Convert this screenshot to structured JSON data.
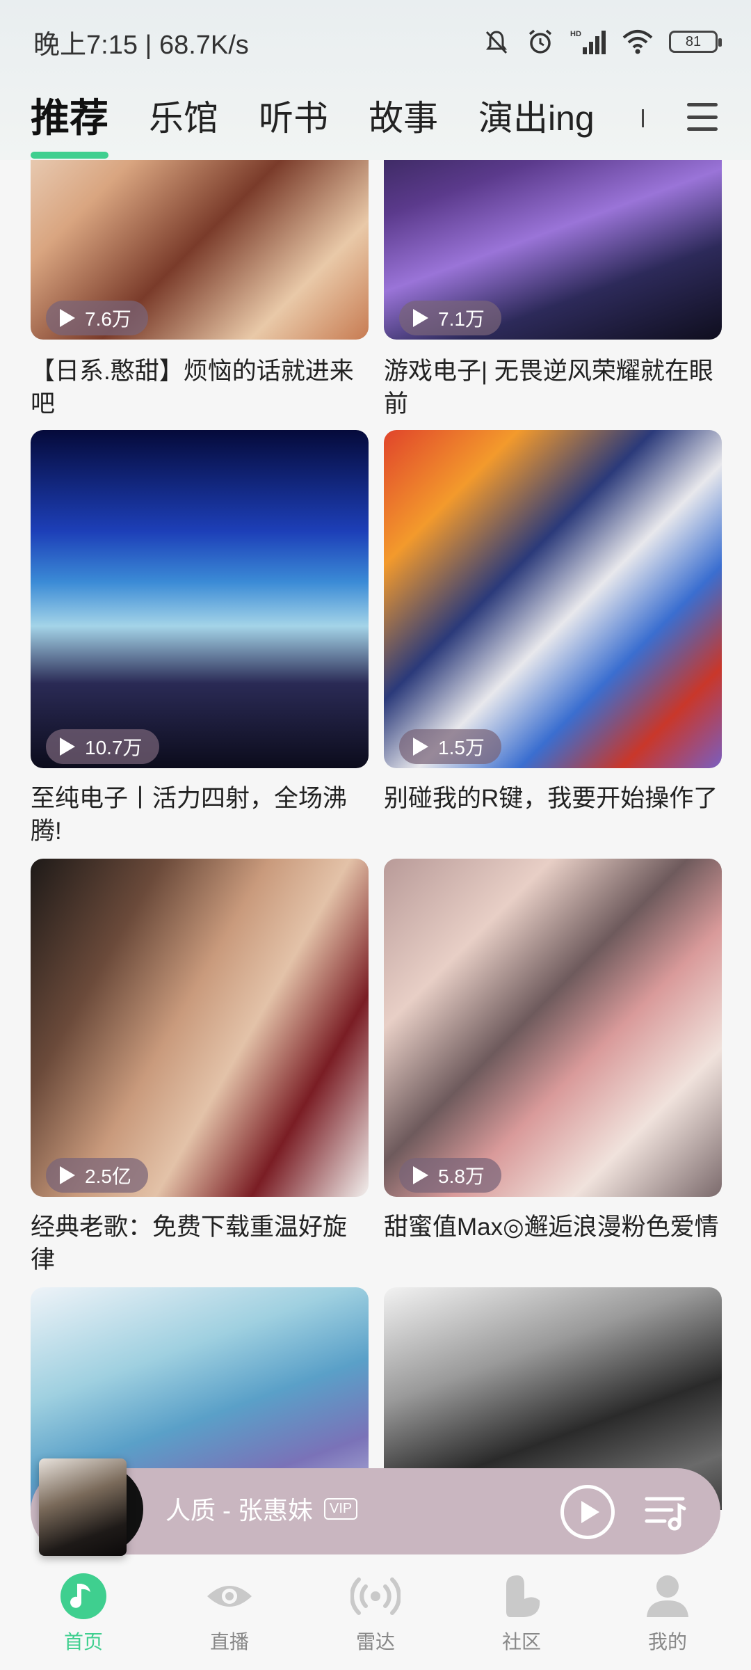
{
  "status_bar": {
    "time_speed": "晚上7:15 | 68.7K/s",
    "battery": "81"
  },
  "tabs": [
    {
      "label": "推荐",
      "active": true
    },
    {
      "label": "乐馆"
    },
    {
      "label": "听书"
    },
    {
      "label": "故事"
    },
    {
      "label": "演出ing"
    }
  ],
  "cards": [
    {
      "plays": "7.6万",
      "title": "【日系.憨甜】烦恼的话就进来吧"
    },
    {
      "plays": "7.1万",
      "title": "游戏电子| 无畏逆风荣耀就在眼前"
    },
    {
      "plays": "10.7万",
      "title": "至纯电子丨活力四射，全场沸腾!"
    },
    {
      "plays": "1.5万",
      "title": "别碰我的R键，我要开始操作了"
    },
    {
      "plays": "2.5亿",
      "title": "经典老歌：免费下载重温好旋律"
    },
    {
      "plays": "5.8万",
      "title": "甜蜜值Max◎邂逅浪漫粉色爱情"
    }
  ],
  "mini_player": {
    "title": "人质 - 张惠妹",
    "badge": "VIP"
  },
  "bottom_nav": [
    {
      "label": "首页",
      "icon": "music-note-icon",
      "active": true
    },
    {
      "label": "直播",
      "icon": "eye-icon"
    },
    {
      "label": "雷达",
      "icon": "radar-icon"
    },
    {
      "label": "社区",
      "icon": "community-icon"
    },
    {
      "label": "我的",
      "icon": "profile-icon"
    }
  ],
  "colors": {
    "accent": "#3fcf8f",
    "player_bg": "#c9b6c0"
  }
}
